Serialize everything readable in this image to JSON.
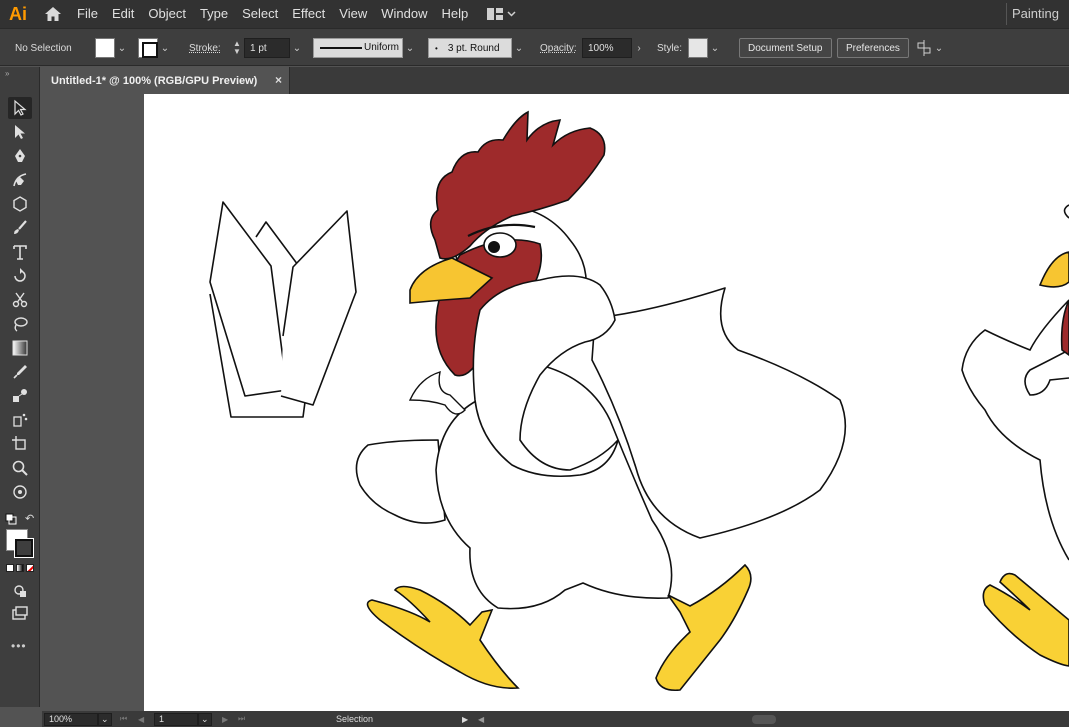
{
  "app": {
    "logo": "Ai",
    "workspace": "Painting"
  },
  "menu": [
    "File",
    "Edit",
    "Object",
    "Type",
    "Select",
    "Effect",
    "View",
    "Window",
    "Help"
  ],
  "control": {
    "selection": "No Selection",
    "stroke_label": "Stroke:",
    "stroke_weight": "1 pt",
    "profile": "Uniform",
    "brush": "3 pt. Round",
    "opacity_label": "Opacity:",
    "opacity_value": "100%",
    "style_label": "Style:",
    "document_setup": "Document Setup",
    "preferences": "Preferences"
  },
  "document": {
    "tab_title": "Untitled-1* @ 100% (RGB/GPU Preview)",
    "close_glyph": "×"
  },
  "status": {
    "zoom": "100%",
    "artboard_number": "1",
    "tool": "Selection"
  },
  "colors": {
    "comb": "#9e2a2b",
    "beak": "#f7c531",
    "feet": "#f9d135",
    "accent": "#ff9a00"
  },
  "tools": [
    "selection-tool",
    "direct-selection-tool",
    "pen-tool",
    "curvature-tool",
    "shape-tool",
    "paintbrush-tool",
    "type-tool",
    "rotate-tool",
    "scissors-tool",
    "lasso-tool",
    "gradient-tool",
    "eyedropper-tool",
    "blend-tool",
    "artboard-tool",
    "zoom-tool",
    "symbol-tool"
  ]
}
